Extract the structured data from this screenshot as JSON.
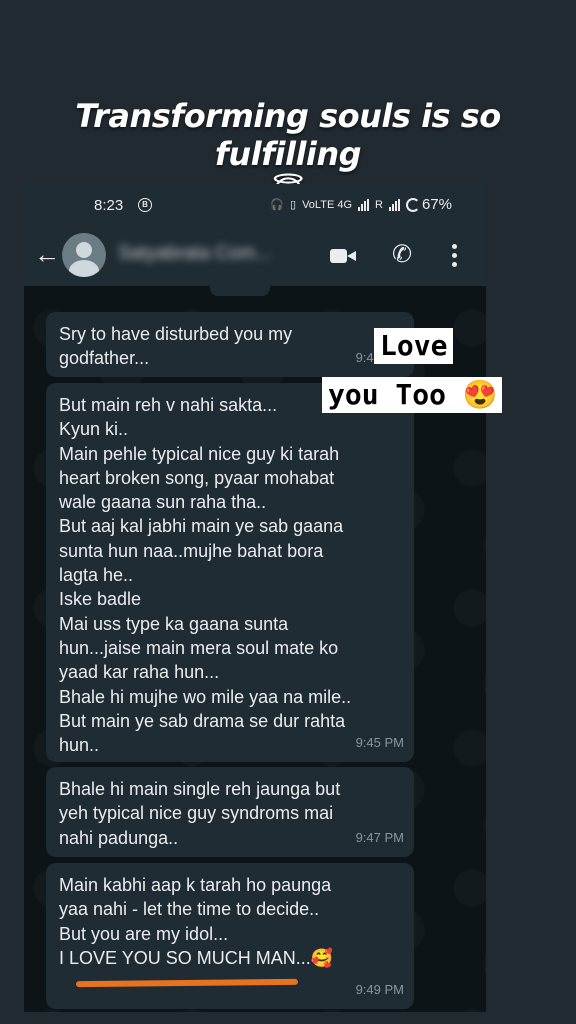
{
  "headline": {
    "text": "Transforming souls is so fulfilling",
    "emoji": "😇"
  },
  "status_bar": {
    "time": "8:23",
    "battery": "67%",
    "network": "VoLTE 4G",
    "signal": "R"
  },
  "chat_header": {
    "contact_name": "Satyabrata Com..."
  },
  "messages": [
    {
      "text": "Sry to have disturbed you my\ngodfather...",
      "time": "9:41 PM"
    },
    {
      "text": "But main reh v nahi sakta...\nKyun ki..\nMain pehle typical nice guy ki tarah\nheart broken song, pyaar mohabat\nwale gaana sun raha tha..\nBut aaj kal jabhi main ye sab gaana\nsunta hun naa..mujhe bahat bora\nlagta he..\nIske badle\nMai uss type ka gaana sunta\nhun...jaise main mera soul mate ko\nyaad kar raha hun...\nBhale hi mujhe wo mile yaa na mile..\nBut main ye sab drama se dur rahta\nhun..",
      "time": "9:45 PM"
    },
    {
      "text": "Bhale hi main single reh jaunga but\nyeh typical nice guy syndroms mai\nnahi padunga..",
      "time": "9:47 PM"
    },
    {
      "text": "Main kabhi aap k tarah ho paunga\nyaa nahi - let the time to decide..\nBut you are my idol...\nI LOVE YOU SO MUCH MAN...🥰",
      "time": "9:49 PM"
    }
  ],
  "stickers": {
    "line1": "Love",
    "line2": "you Too 😍"
  },
  "colors": {
    "bubble": "#202c33",
    "underline": "#e8731e",
    "chat_bg": "#0d1418"
  }
}
